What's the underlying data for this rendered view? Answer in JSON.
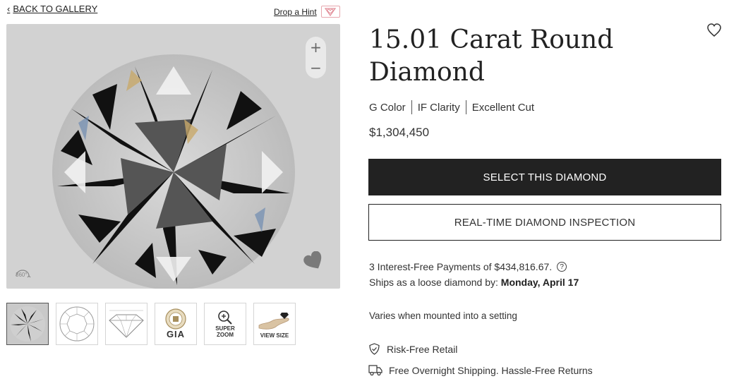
{
  "nav": {
    "back_label": "BACK TO GALLERY",
    "hint_label": "Drop a Hint"
  },
  "viewer": {
    "zoom_in": "+",
    "zoom_out": "−",
    "rotate_label": "360°"
  },
  "thumbnails": [
    {
      "name": "diamond-photo",
      "caption": ""
    },
    {
      "name": "top-diagram",
      "caption": ""
    },
    {
      "name": "profile-diagram",
      "caption": ""
    },
    {
      "name": "gia-certificate",
      "caption": "GIA"
    },
    {
      "name": "super-zoom",
      "caption_line1": "SUPER",
      "caption_line2": "ZOOM"
    },
    {
      "name": "view-size",
      "caption": "VIEW SIZE"
    }
  ],
  "product": {
    "title": "15.01 Carat Round Diamond",
    "color": "G Color",
    "clarity": "IF Clarity",
    "cut": "Excellent Cut",
    "price": "$1,304,450"
  },
  "actions": {
    "select_label": "SELECT THIS DIAMOND",
    "inspect_label": "REAL-TIME DIAMOND INSPECTION"
  },
  "info": {
    "payments": "3 Interest-Free Payments of $434,816.67.",
    "ships_prefix": "Ships as a loose diamond by:",
    "ships_date": "Monday, April 17",
    "varies": "Varies when mounted into a setting"
  },
  "features": [
    {
      "icon": "shield-check-icon",
      "label": "Risk-Free Retail"
    },
    {
      "icon": "truck-icon",
      "label": "Free Overnight Shipping. Hassle-Free Returns"
    }
  ],
  "colors": {
    "primary_button": "#222222",
    "hint_accent": "#e7a6ad",
    "viewer_bg": "#d2d2d2"
  }
}
